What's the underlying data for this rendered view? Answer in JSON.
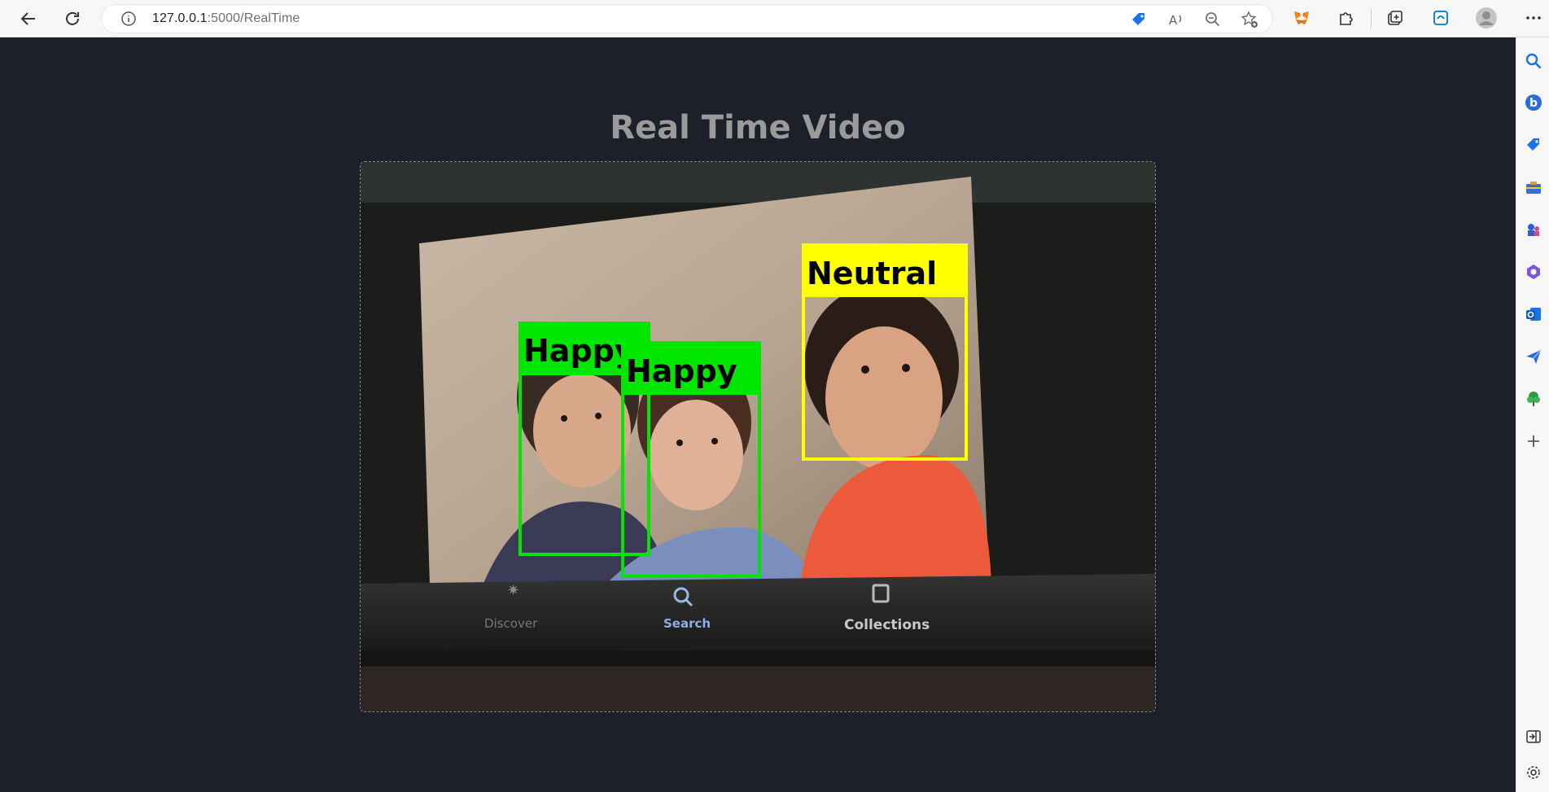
{
  "browser": {
    "url_host": "127.0.0.1",
    "url_path": ":5000/RealTime"
  },
  "page": {
    "title": "Real Time Video"
  },
  "video": {
    "detections": [
      {
        "label": "Happy",
        "color": "#00e600"
      },
      {
        "label": "Happy",
        "color": "#00e600"
      },
      {
        "label": "Neutral",
        "color": "#ffff00"
      }
    ],
    "screen_tabs": [
      "Discover",
      "Search",
      "Collections"
    ]
  },
  "colors": {
    "background": "#1d2028",
    "title": "#9a9a9a",
    "happy_box": "#00e600",
    "neutral_box": "#ffff00"
  }
}
